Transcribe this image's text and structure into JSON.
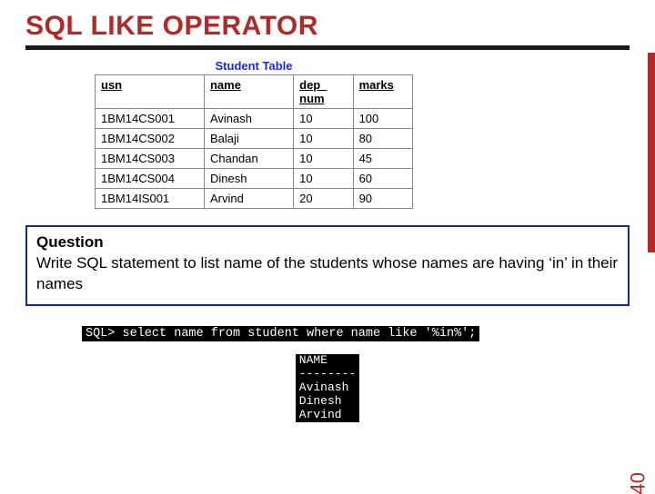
{
  "title": "SQL LIKE OPERATOR",
  "tableCaption": "Student Table",
  "headers": {
    "usn": "usn",
    "name": "name",
    "dep": "dep_ num",
    "marks": "marks"
  },
  "rows": [
    {
      "usn": "1BM14CS001",
      "name": "Avinash",
      "dep": "10",
      "marks": "100"
    },
    {
      "usn": "1BM14CS002",
      "name": "Balaji",
      "dep": "10",
      "marks": "80"
    },
    {
      "usn": "1BM14CS003",
      "name": "Chandan",
      "dep": "10",
      "marks": "45"
    },
    {
      "usn": "1BM14CS004",
      "name": "Dinesh",
      "dep": "10",
      "marks": "60"
    },
    {
      "usn": "1BM14IS001",
      "name": "Arvind",
      "dep": "20",
      "marks": "90"
    }
  ],
  "question": {
    "label": "Question",
    "text": "Write SQL statement to list name of the students whose names are having ‘in’ in their names"
  },
  "sql": "SQL> select name from student where name like '%in%';",
  "result": {
    "header": "NAME",
    "divider": "--------",
    "rows": [
      "Avinash",
      "Dinesh",
      "Arvind"
    ]
  },
  "pageNumber": "40",
  "chart_data": {
    "type": "table",
    "title": "Student Table",
    "columns": [
      "usn",
      "name",
      "dep_num",
      "marks"
    ],
    "rows": [
      [
        "1BM14CS001",
        "Avinash",
        10,
        100
      ],
      [
        "1BM14CS002",
        "Balaji",
        10,
        80
      ],
      [
        "1BM14CS003",
        "Chandan",
        10,
        45
      ],
      [
        "1BM14CS004",
        "Dinesh",
        10,
        60
      ],
      [
        "1BM14IS001",
        "Arvind",
        20,
        90
      ]
    ]
  }
}
